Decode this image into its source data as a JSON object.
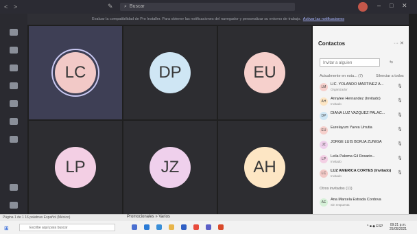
{
  "titlebar": {
    "search_placeholder": "Buscar",
    "nav": "< >",
    "minimize": "–",
    "maximize": "□",
    "close": "✕"
  },
  "banner": {
    "text": "Evaluar la compatibilidad de Pro Installer. Para obtener las notificaciones del navegador y personalizar su entorno de trabajo.",
    "link": "Activar las notificaciones"
  },
  "tiles": [
    {
      "initials": "LC",
      "color": "#f2c9c7",
      "active": true
    },
    {
      "initials": "DP",
      "color": "#cfe6f4"
    },
    {
      "initials": "EU",
      "color": "#f6d0cc"
    },
    {
      "initials": "LP",
      "color": "#f3cfe4"
    },
    {
      "initials": "JZ",
      "color": "#efd0ec"
    },
    {
      "initials": "AH",
      "color": "#fde6c4"
    }
  ],
  "panel": {
    "title": "Contactos",
    "controls": "··· ✕",
    "invite_placeholder": "Invitar a alguien",
    "invite_icon": "⇆",
    "in_meeting": "Actualmente en esta... (7)",
    "mute_all": "Silenciar a todos",
    "others": "Otros invitados (11)",
    "participants": [
      {
        "name": "LIC. YOLANDO MARTÍNEZ A...",
        "sub": "Organizador",
        "initials": "LM",
        "color": "#f6d0cc"
      },
      {
        "name": "Annylee Hernandez (Invitado)",
        "sub": "Invitado",
        "initials": "AH",
        "color": "#fde6c4"
      },
      {
        "name": "DIANA LUZ VAZQUEZ PALAC...",
        "sub": "",
        "initials": "DP",
        "color": "#cfe6f4"
      },
      {
        "name": "Eurelayum Yavva Urrutia",
        "sub": "",
        "initials": "EU",
        "color": "#f6d0cc"
      },
      {
        "name": "JORGE LUIS BORJA ZUNIGA",
        "sub": "",
        "initials": "JZ",
        "color": "#efd0ec"
      },
      {
        "name": "Leila Paloma Gil Rosario...",
        "sub": "Invitado",
        "initials": "LP",
        "color": "#f3cfe4"
      },
      {
        "name": "LUZ AMERICA CORTÉS (Invitado)",
        "sub": "Invitado",
        "initials": "LC",
        "color": "#f2c9c7",
        "bold": true
      }
    ],
    "other_participant": {
      "name": "Ana Marcela Estrada Cordova",
      "sub": "Sin respuesta",
      "initials": "AE",
      "color": "#d6f0d8"
    }
  },
  "statusbar": {
    "left": "Página 1 de 1   16 palabras   Español (México)",
    "mid": "Promocionales » Varios"
  },
  "taskbar": {
    "search_placeholder": "Escribe aquí para buscar",
    "tray": "^ ■ ◆ ESP",
    "time": "09:21 p.m.",
    "date": "25/05/2021"
  }
}
